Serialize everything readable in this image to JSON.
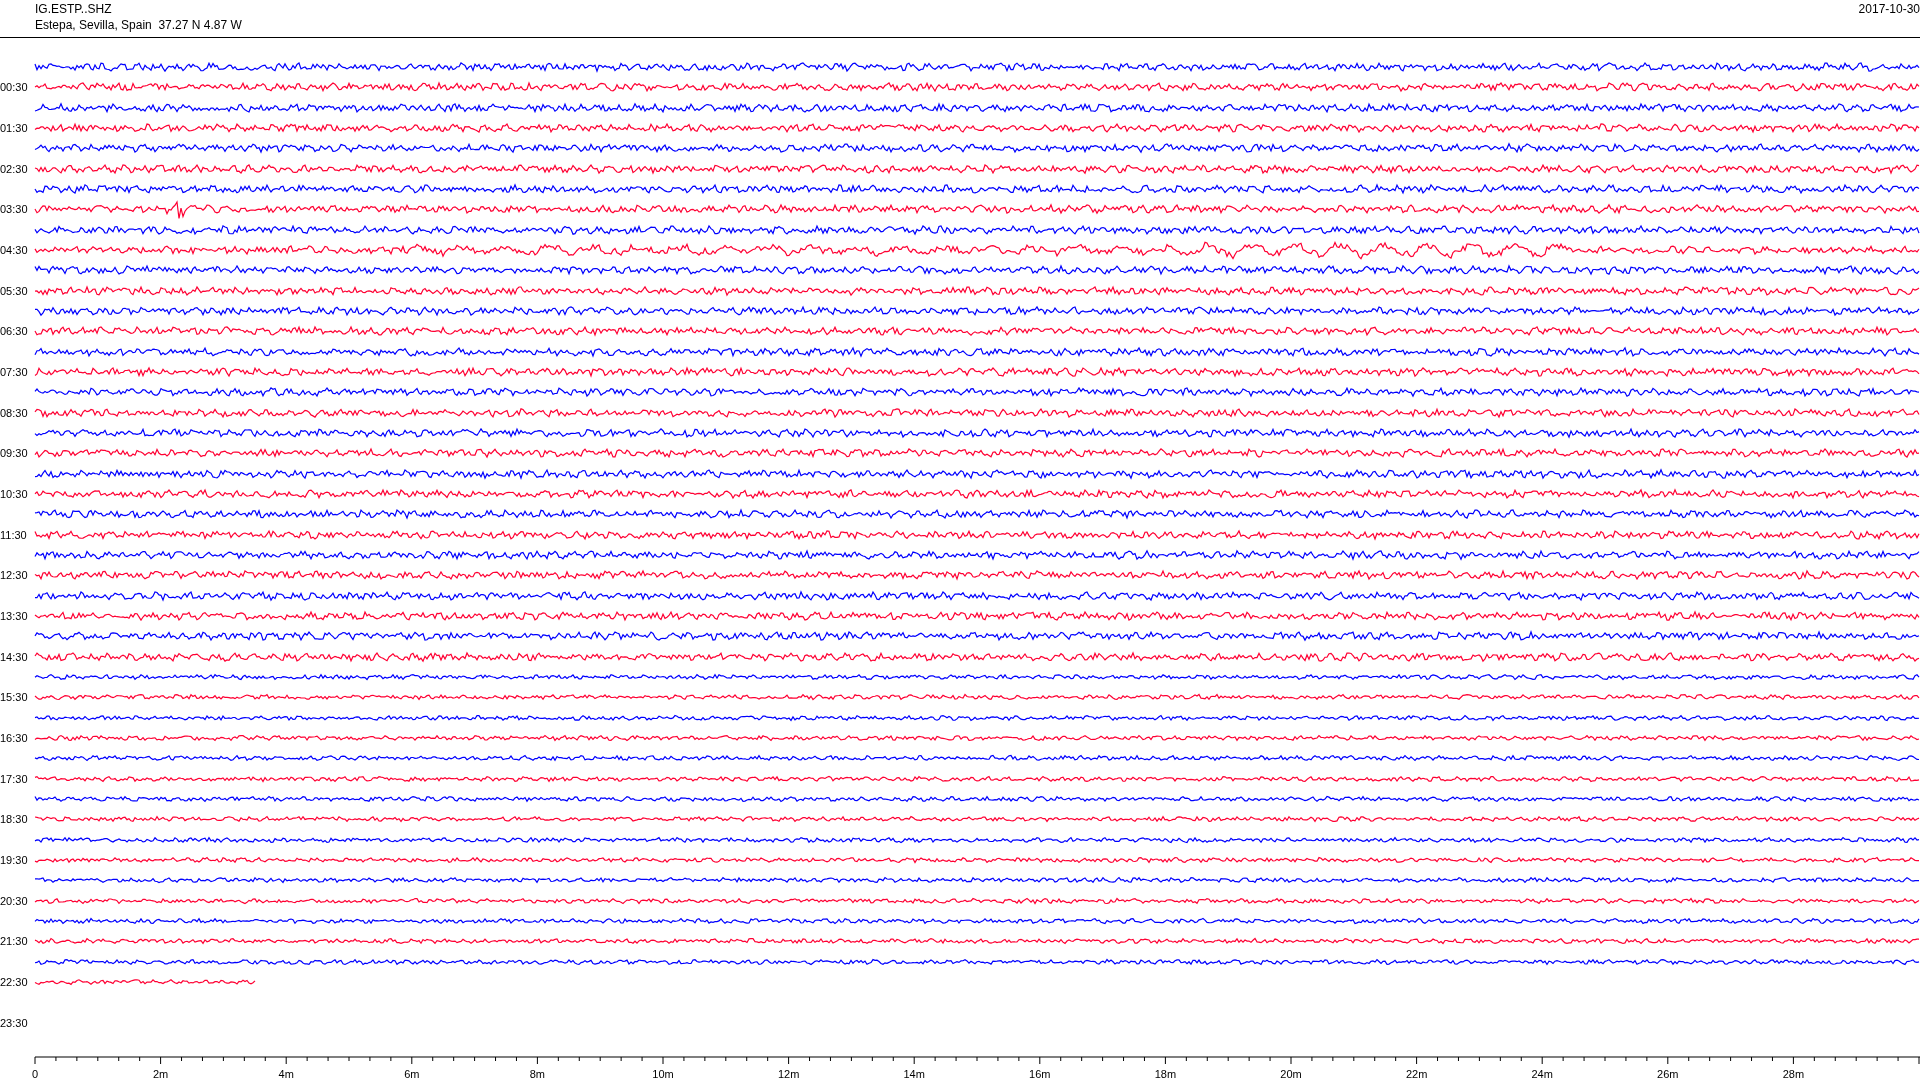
{
  "header": {
    "station": "IG.ESTP..SHZ",
    "location": "Estepa, Sevilla, Spain  37.27 N 4.87 W",
    "date": "2017-10-30"
  },
  "rows": [
    {
      "trace": {
        "color": "#0000ff",
        "kind": "noise",
        "level": 1
      }
    },
    {
      "label": "00:30",
      "trace": {
        "color": "#ff0033",
        "kind": "noise",
        "level": 1
      }
    },
    {
      "trace": {
        "color": "#0000ff",
        "kind": "noise",
        "level": 1
      }
    },
    {
      "label": "01:30",
      "trace": {
        "color": "#ff0033",
        "kind": "noise",
        "level": 1
      }
    },
    {
      "trace": {
        "color": "#0000ff",
        "kind": "noise",
        "level": 1
      }
    },
    {
      "label": "02:30",
      "trace": {
        "color": "#ff0033",
        "kind": "noise",
        "level": 1
      }
    },
    {
      "trace": {
        "color": "#0000ff",
        "kind": "noise",
        "level": 1
      }
    },
    {
      "label": "03:30",
      "trace": {
        "color": "#ff0033",
        "kind": "quake",
        "level": 1
      }
    },
    {
      "trace": {
        "color": "#0000ff",
        "kind": "noise",
        "level": 1
      }
    },
    {
      "label": "04:30",
      "trace": {
        "color": "#ff0033",
        "kind": "long-period",
        "level": 1
      }
    },
    {
      "trace": {
        "color": "#0000ff",
        "kind": "noise",
        "level": 1
      }
    },
    {
      "label": "05:30",
      "trace": {
        "color": "#ff0033",
        "kind": "noise",
        "level": 1
      }
    },
    {
      "trace": {
        "color": "#0000ff",
        "kind": "noise",
        "level": 1
      }
    },
    {
      "label": "06:30",
      "trace": {
        "color": "#ff0033",
        "kind": "noise",
        "level": 1
      }
    },
    {
      "trace": {
        "color": "#0000ff",
        "kind": "noise",
        "level": 1
      }
    },
    {
      "label": "07:30",
      "trace": {
        "color": "#ff0033",
        "kind": "noise",
        "level": 1
      }
    },
    {
      "trace": {
        "color": "#0000ff",
        "kind": "noise",
        "level": 1
      }
    },
    {
      "label": "08:30",
      "trace": {
        "color": "#ff0033",
        "kind": "noise",
        "level": 1
      }
    },
    {
      "trace": {
        "color": "#0000ff",
        "kind": "noise",
        "level": 1
      }
    },
    {
      "label": "09:30",
      "trace": {
        "color": "#ff0033",
        "kind": "noise",
        "level": 1
      }
    },
    {
      "trace": {
        "color": "#0000ff",
        "kind": "noise",
        "level": 1
      }
    },
    {
      "label": "10:30",
      "trace": {
        "color": "#ff0033",
        "kind": "noise",
        "level": 1
      }
    },
    {
      "trace": {
        "color": "#0000ff",
        "kind": "noise",
        "level": 1
      }
    },
    {
      "label": "11:30",
      "trace": {
        "color": "#ff0033",
        "kind": "noise",
        "level": 1
      }
    },
    {
      "trace": {
        "color": "#0000ff",
        "kind": "noise",
        "level": 1
      }
    },
    {
      "label": "12:30",
      "trace": {
        "color": "#ff0033",
        "kind": "noise",
        "level": 1
      }
    },
    {
      "trace": {
        "color": "#0000ff",
        "kind": "noise",
        "level": 1
      }
    },
    {
      "label": "13:30",
      "trace": {
        "color": "#ff0033",
        "kind": "noise",
        "level": 1
      }
    },
    {
      "trace": {
        "color": "#0000ff",
        "kind": "noise",
        "level": 1
      }
    },
    {
      "label": "14:30",
      "trace": {
        "color": "#ff0033",
        "kind": "noise",
        "level": 1
      }
    },
    {
      "trace": {
        "color": "#0000ff",
        "kind": "noise",
        "level": 1
      }
    },
    {
      "label": "15:30",
      "trace": {
        "color": "#ff0033",
        "kind": "noise",
        "level": 1
      }
    },
    {
      "trace": {
        "color": "#0000ff",
        "kind": "noise",
        "level": 1
      }
    },
    {
      "label": "16:30",
      "trace": {
        "color": "#ff0033",
        "kind": "noise",
        "level": 1
      }
    },
    {
      "trace": {
        "color": "#0000ff",
        "kind": "noise",
        "level": 1
      }
    },
    {
      "label": "17:30",
      "trace": {
        "color": "#ff0033",
        "kind": "noise",
        "level": 1
      }
    },
    {
      "trace": {
        "color": "#0000ff",
        "kind": "noise",
        "level": 1
      }
    },
    {
      "label": "18:30",
      "trace": {
        "color": "#ff0033",
        "kind": "noise",
        "level": 1
      }
    },
    {
      "trace": {
        "color": "#0000ff",
        "kind": "noise",
        "level": 1
      }
    },
    {
      "label": "19:30",
      "trace": {
        "color": "#ff0033",
        "kind": "noise",
        "level": 1
      }
    },
    {
      "trace": {
        "color": "#0000ff",
        "kind": "noise",
        "level": 1
      }
    },
    {
      "label": "20:30",
      "trace": {
        "color": "#ff0033",
        "kind": "noise",
        "level": 1
      }
    },
    {
      "trace": {
        "color": "#0000ff",
        "kind": "noise",
        "level": 1
      }
    },
    {
      "label": "21:30",
      "trace": {
        "color": "#ff0033",
        "kind": "noise",
        "level": 1
      }
    },
    {
      "trace": {
        "color": "#0000ff",
        "kind": "noise",
        "level": 1
      }
    },
    {
      "label": "22:30",
      "trace": {
        "color": "#ff0033",
        "kind": "noise",
        "level": 0.117
      }
    },
    {},
    {
      "label": "23:30"
    }
  ],
  "axis": {
    "labels": [
      "0",
      "2m",
      "4m",
      "6m",
      "8m",
      "10m",
      "12m",
      "14m",
      "16m",
      "18m",
      "20m",
      "22m",
      "24m",
      "26m",
      "28m"
    ]
  }
}
